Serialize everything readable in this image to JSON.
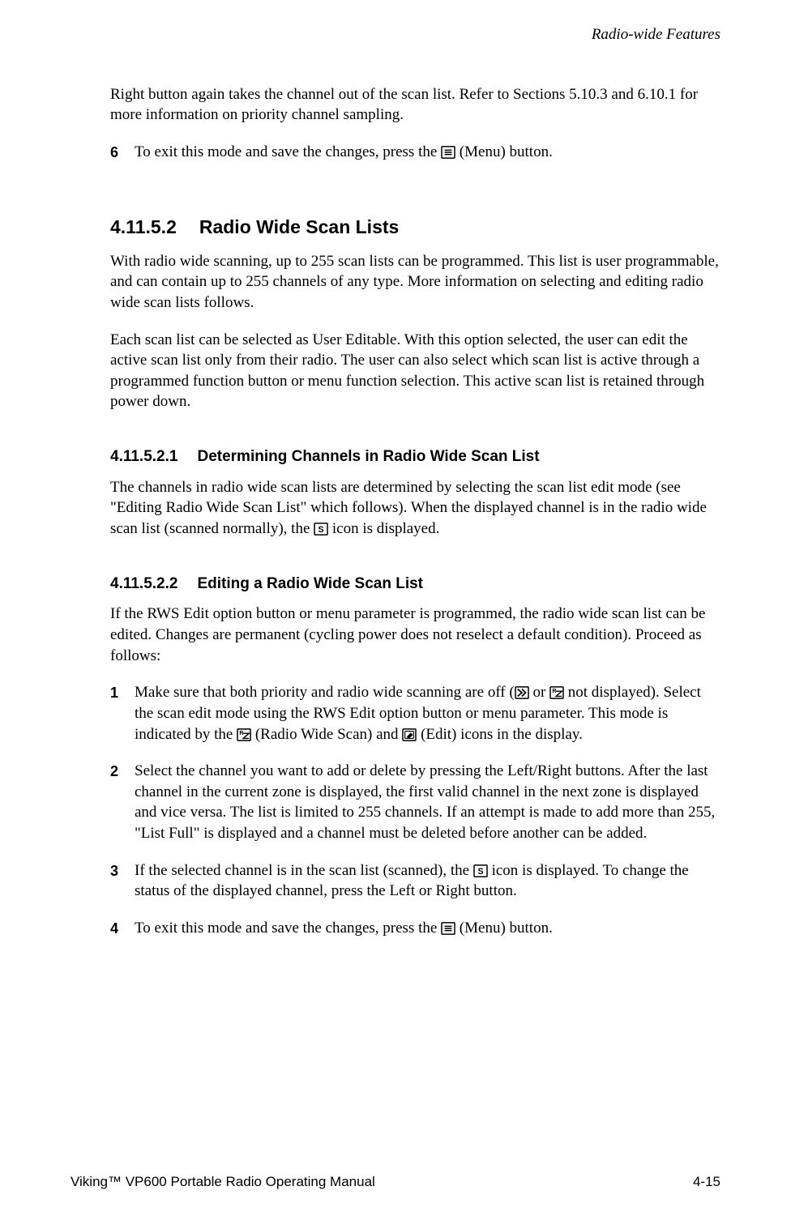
{
  "running_head": "Radio-wide Features",
  "intro_para": "Right button again takes the channel out of the scan list. Refer to Sections 5.10.3 and 6.10.1 for more information on priority channel sampling.",
  "step6_num": "6",
  "step6_a": "To exit this mode and save the changes, press the ",
  "step6_b": " (Menu) button.",
  "sec1_num": "4.11.5.2",
  "sec1_title": "Radio Wide Scan Lists",
  "sec1_p1": "With radio wide scanning, up to 255 scan lists can be programmed. This list is user programmable, and can contain up to 255 channels of any type. More information on selecting and editing radio wide scan lists follows.",
  "sec1_p2": "Each scan list can be selected as User Editable. With this option selected, the user can edit the active scan list only from their radio. The user can also select which scan list is active through a programmed function button or menu function selection. This active scan list is retained through power down.",
  "sec2_num": "4.11.5.2.1",
  "sec2_title": "Determining Channels in Radio Wide Scan List",
  "sec2_p1a": "The channels in radio wide scan lists are determined by selecting the scan list edit mode (see \"Editing Radio Wide Scan List\" which follows). When the displayed channel is in the radio wide scan list (scanned normally), the ",
  "sec2_p1b": " icon is displayed.",
  "sec3_num": "4.11.5.2.2",
  "sec3_title": "Editing a Radio Wide Scan List",
  "sec3_p1": "If the RWS Edit option button or menu parameter is programmed, the radio wide scan list can be edited. Changes are permanent (cycling power does not reselect a default condition). Proceed as follows:",
  "s1_num": "1",
  "s1_a": "Make sure that both priority and radio wide scanning are off (",
  "s1_b": " or ",
  "s1_c": " not displayed). Select the scan edit mode using the RWS Edit option button or menu parameter. This mode is indicated by the ",
  "s1_d": " (Radio Wide Scan) and ",
  "s1_e": " (Edit) icons in the display.",
  "s2_num": "2",
  "s2_body": "Select the channel you want to add or delete by pressing the Left/Right buttons. After the last channel in the current zone is displayed, the first valid channel in the next zone is displayed and vice versa. The list is limited to 255 channels. If an attempt is made to add more than 255, \"List Full\" is displayed and a channel must be deleted before another can be added.",
  "s3_num": "3",
  "s3_a": "If the selected channel is in the scan list (scanned), the ",
  "s3_b": " icon is displayed. To change the status of the displayed channel, press the Left or Right button.",
  "s4_num": "4",
  "s4_a": "To exit this mode and save the changes, press the ",
  "s4_b": " (Menu) button.",
  "footer_left": "Viking™ VP600 Portable Radio Operating Manual",
  "footer_right": "4-15"
}
